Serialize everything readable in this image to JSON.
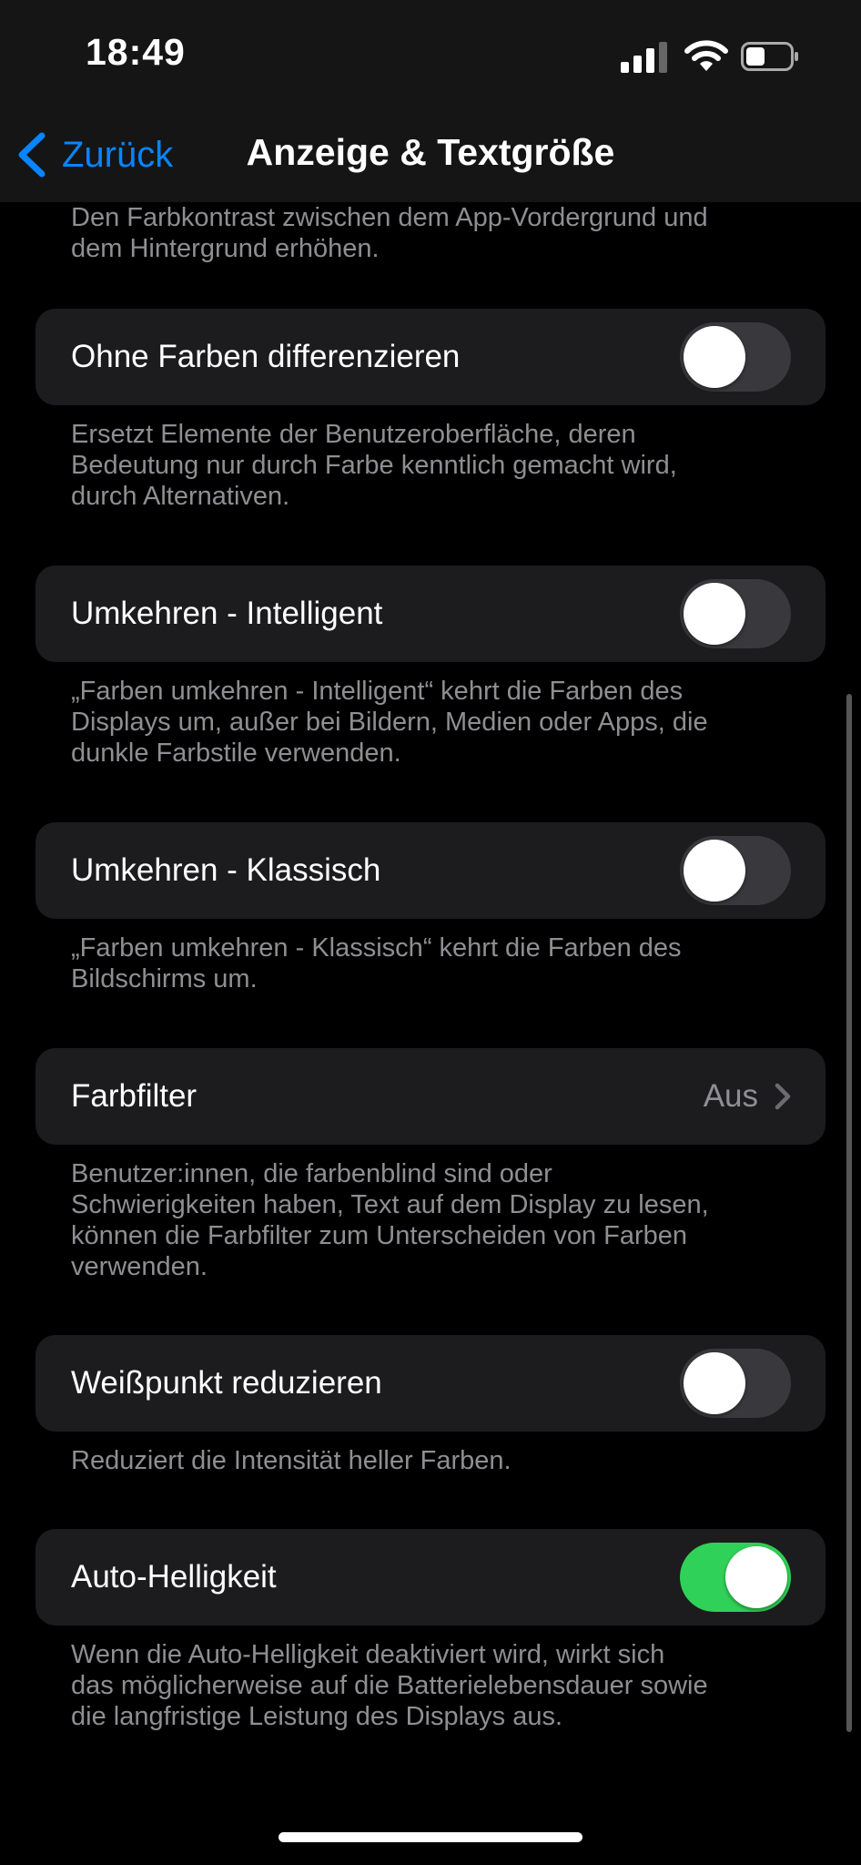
{
  "status": {
    "time": "18:49"
  },
  "nav": {
    "back_label": "Zurück",
    "title": "Anzeige & Textgröße"
  },
  "sections": {
    "top_footer": "Den Farbkontrast zwischen dem App-Vordergrund und\ndem Hintergrund erhöhen.",
    "differentiate": {
      "label": "Ohne Farben differenzieren",
      "on": false,
      "footer": "Ersetzt Elemente der Benutzeroberfläche, deren\nBedeutung nur durch Farbe kenntlich gemacht wird,\ndurch Alternativen."
    },
    "smart_invert": {
      "label": "Umkehren - Intelligent",
      "on": false,
      "footer": "„Farben umkehren - Intelligent“ kehrt die Farben des\nDisplays um, außer bei Bildern, Medien oder Apps, die\ndunkle Farbstile verwenden."
    },
    "classic_invert": {
      "label": "Umkehren - Klassisch",
      "on": false,
      "footer": "„Farben umkehren - Klassisch“ kehrt die Farben des\nBildschirms um."
    },
    "color_filters": {
      "label": "Farbfilter",
      "value": "Aus",
      "footer": "Benutzer:innen, die farbenblind sind oder\nSchwierigkeiten haben, Text auf dem Display zu lesen,\nkönnen die Farbfilter zum Unterscheiden von Farben\nverwenden."
    },
    "reduce_white_point": {
      "label": "Weißpunkt reduzieren",
      "on": false,
      "footer": "Reduziert die Intensität heller Farben."
    },
    "auto_brightness": {
      "label": "Auto-Helligkeit",
      "on": true,
      "footer": "Wenn die Auto-Helligkeit deaktiviert wird, wirkt sich\ndas möglicherweise auf die Batterielebensdauer sowie\ndie langfristige Leistung des Displays aus."
    }
  },
  "colors": {
    "accent": "#0a84ff",
    "toggle_on": "#30d158",
    "toggle_off": "#39393d",
    "cell_bg": "#1c1c1e",
    "secondary_text": "#8e8e93"
  }
}
